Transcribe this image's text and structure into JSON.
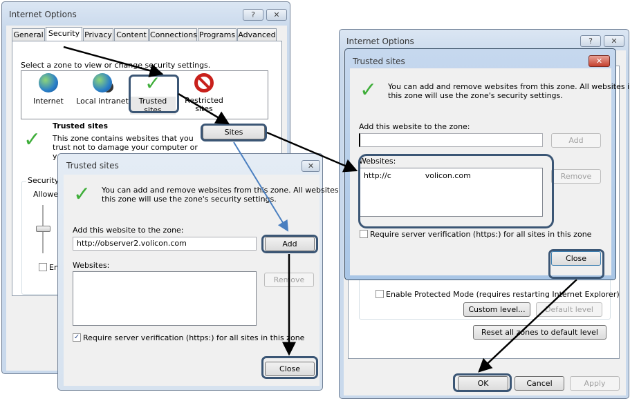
{
  "left_window": {
    "title": "Internet Options",
    "help": "?",
    "close": "✕",
    "tabs": [
      "General",
      "Security",
      "Privacy",
      "Content",
      "Connections",
      "Programs",
      "Advanced"
    ],
    "zone_prompt": "Select a zone to view or change security settings.",
    "zones": [
      "Internet",
      "Local intranet",
      "Trusted sites",
      "Restricted sites"
    ],
    "zone_title": "Trusted sites",
    "sites_button": "Sites",
    "zone_desc": [
      "This zone contains websites that you",
      "trust not to damage your computer or",
      "y"
    ],
    "security_group": "Security",
    "allowed": "Allowed",
    "enable_partial": "En"
  },
  "left_dialog": {
    "title": "Trusted sites",
    "close": "✕",
    "info": [
      "You can add and remove websites from this zone. All websites in",
      "this zone will use the zone's security settings."
    ],
    "add_label": "Add this website to the zone:",
    "add_value": "http://observer2.volicon.com",
    "add_button": "Add",
    "websites_label": "Websites:",
    "websites": [],
    "remove_button": "Remove",
    "require_label": "Require server verification (https:) for all sites in this zone",
    "require_checked": true,
    "close_button": "Close"
  },
  "right_window": {
    "title": "Internet Options",
    "help": "?",
    "close": "✕",
    "protected_mode": "Enable Protected Mode (requires restarting Internet Explorer)",
    "custom_level": "Custom level...",
    "default_level": "Default level",
    "reset_all": "Reset all zones to default level",
    "ok": "OK",
    "cancel": "Cancel",
    "apply": "Apply"
  },
  "right_dialog": {
    "title": "Trusted sites",
    "close": "✕",
    "info": [
      "You can add and remove websites from this zone. All websites in",
      "this zone will use the zone's security settings."
    ],
    "add_label": "Add this website to the zone:",
    "add_value": "",
    "add_button": "Add",
    "websites_label": "Websites:",
    "websites": [
      "http://c              volicon.com"
    ],
    "remove_button": "Remove",
    "require_label": "Require server verification (https:) for all sites in this zone",
    "require_checked": false,
    "close_button": "Close"
  },
  "colors": {
    "highlight": "#3b5675",
    "arrow_black": "#000000",
    "arrow_blue": "#4a7fc0",
    "check_green": "#3fae3a"
  }
}
